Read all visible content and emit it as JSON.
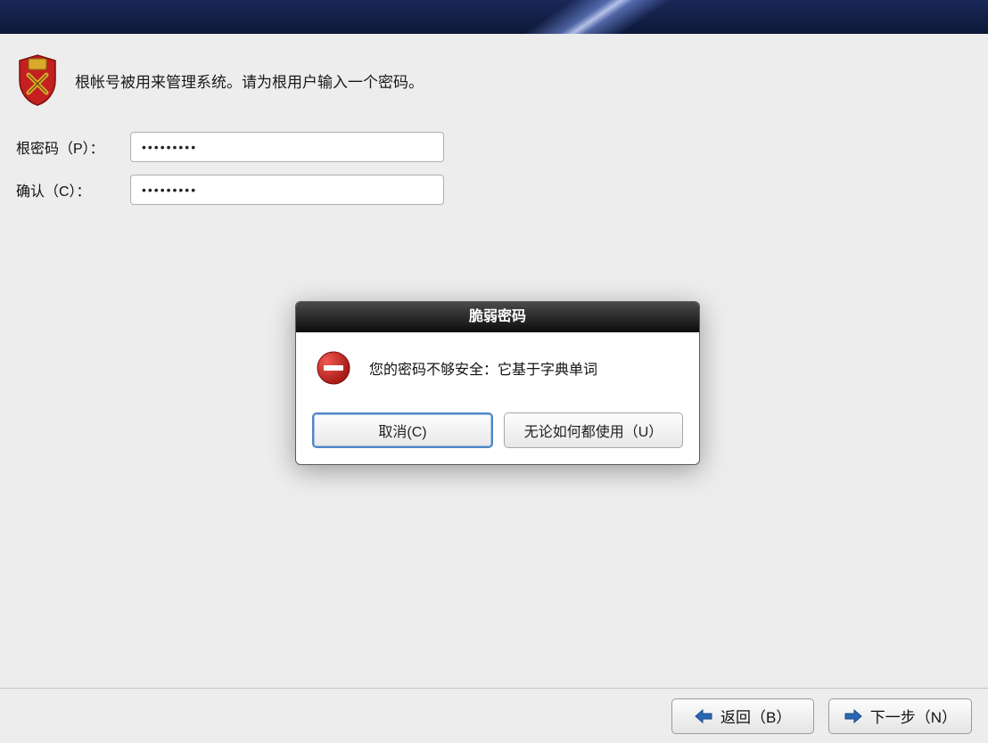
{
  "intro": {
    "text": "根帐号被用来管理系统。请为根用户输入一个密码。"
  },
  "form": {
    "root_password_label": "根密码（P）：",
    "confirm_label": "确认（C）：",
    "root_password_value": "•••••••••",
    "confirm_value": "•••••••••"
  },
  "dialog": {
    "title": "脆弱密码",
    "message": "您的密码不够安全：它基于字典单词",
    "cancel_label": "取消(C)",
    "use_anyway_label": "无论如何都使用（U）"
  },
  "footer": {
    "back_label": "返回（B）",
    "next_label": "下一步（N）"
  },
  "colors": {
    "banner_dark": "#0d1838",
    "error_red": "#c62925",
    "shield_red": "#c3201f",
    "shield_gold": "#d8a92a"
  }
}
